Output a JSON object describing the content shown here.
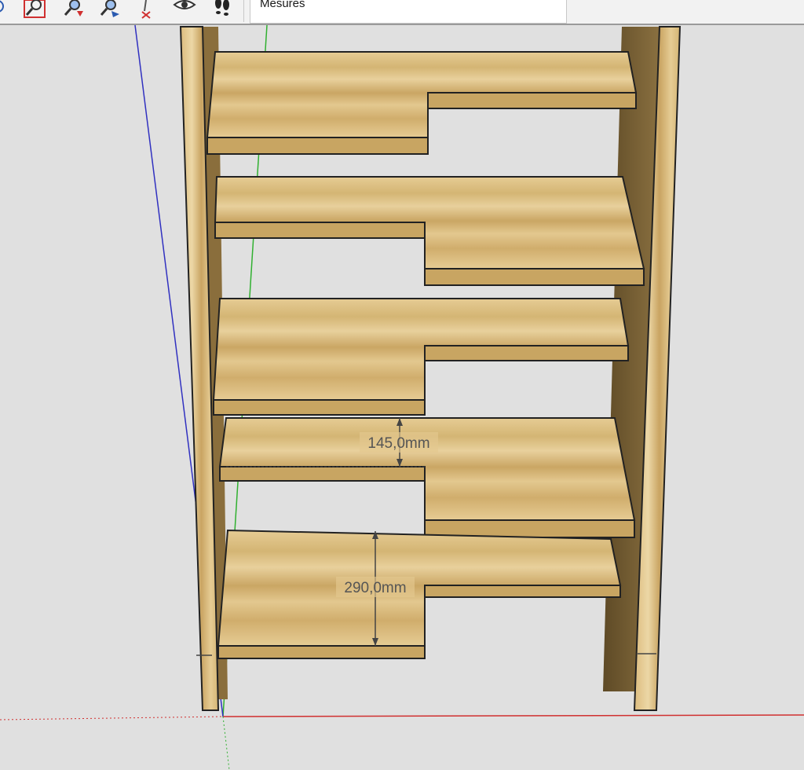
{
  "toolbar": {
    "tools": [
      {
        "name": "orbit-icon",
        "label": ""
      },
      {
        "name": "zoom-window-icon",
        "label": ""
      },
      {
        "name": "zoom-extents-icon",
        "label": ""
      },
      {
        "name": "previous-view-icon",
        "label": ""
      },
      {
        "name": "position-camera-icon",
        "label": ""
      },
      {
        "name": "look-around-icon",
        "label": ""
      },
      {
        "name": "walk-icon",
        "label": ""
      }
    ],
    "measures_label": "Mesures"
  },
  "model": {
    "dimensions": [
      {
        "label": "145,0mm"
      },
      {
        "label": "290,0mm"
      }
    ]
  },
  "colors": {
    "background": "#e0e0e0",
    "wood_light": "#e3c88f",
    "wood_dark": "#c9a462",
    "side_panel_shadow": "#7a6236",
    "axis_red": "#d03030",
    "axis_green": "#30b030",
    "axis_blue": "#3030c0"
  }
}
